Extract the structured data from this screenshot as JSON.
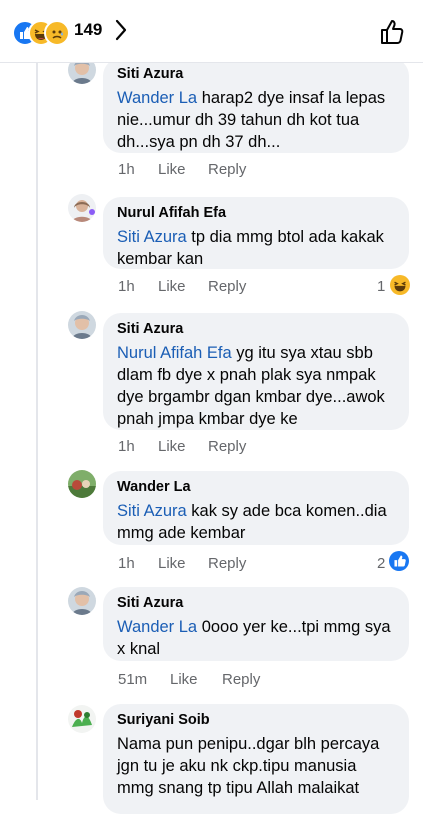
{
  "header": {
    "reaction_icons": [
      "like-icon",
      "haha-icon",
      "sad-icon"
    ],
    "reaction_count": "149",
    "colors": {
      "like": "#1877f2",
      "emoji": "#f7b928",
      "mention": "#1b5eb5",
      "bubble": "#f0f2f5",
      "meta": "#65676b"
    }
  },
  "comments": [
    {
      "author": "Siti Azura",
      "mention": "Wander La",
      "text": " harap2 dye insaf la lepas nie...umur dh 39 tahun dh kot tua dh...sya pn dh 37 dh...",
      "time": "1h",
      "like": "Like",
      "reply": "Reply",
      "reaction_count": ""
    },
    {
      "author": "Nurul Afifah Efa",
      "mention": "Siti Azura",
      "text": " tp dia mmg btol ada kakak kembar kan",
      "time": "1h",
      "like": "Like",
      "reply": "Reply",
      "reaction_count": "1",
      "reaction": "haha"
    },
    {
      "author": "Siti Azura",
      "mention": "Nurul Afifah Efa",
      "text": " yg itu sya xtau sbb dlam fb dye x pnah plak sya nmpak dye brgambr dgan kmbar dye...awok pnah jmpa kmbar dye ke",
      "time": "1h",
      "like": "Like",
      "reply": "Reply",
      "reaction_count": ""
    },
    {
      "author": "Wander La",
      "mention": "Siti Azura",
      "text": " kak sy ade bca komen..dia mmg ade kembar",
      "time": "1h",
      "like": "Like",
      "reply": "Reply",
      "reaction_count": "2",
      "reaction": "like"
    },
    {
      "author": "Siti Azura",
      "mention": "Wander La",
      "text": " 0ooo yer ke...tpi mmg sya x knal",
      "time": "51m",
      "like": "Like",
      "reply": "Reply",
      "reaction_count": ""
    },
    {
      "author": "Suriyani Soib",
      "mention": "",
      "text": "Nama pun penipu..dgar blh percaya jgn tu je aku nk ckp.tipu manusia mmg snang tp tipu Allah malaikat",
      "time": "",
      "like": "",
      "reply": "",
      "reaction_count": ""
    }
  ]
}
